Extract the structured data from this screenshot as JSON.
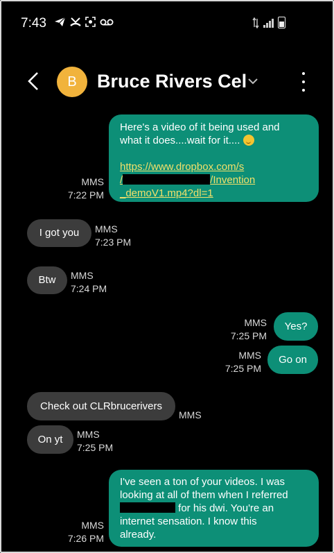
{
  "status_bar": {
    "time": "7:43",
    "left_icons": [
      "telegram-icon",
      "missed-call-icon",
      "screenshot-icon",
      "voicemail-icon"
    ],
    "right_icons": [
      "data-arrows-icon",
      "signal-icon",
      "battery-icon"
    ]
  },
  "header": {
    "avatar_letter": "B",
    "avatar_color": "#f1b33c",
    "contact_name": "Bruce Rivers Cel"
  },
  "colors": {
    "sent_bubble": "#0d8f77",
    "received_bubble": "#3c3c3c",
    "link": "#f2e06a"
  },
  "messages": [
    {
      "direction": "sent",
      "line1": "Here's a video of it being used and",
      "line2": "what it does....wait for it....",
      "link_line1": "https://www.dropbox.com/s",
      "link_line2_start": "/",
      "link_line2_end": "/Invention",
      "link_line3": "_demoV1.mp4?dl=1",
      "type": "MMS",
      "time": "7:22 PM"
    },
    {
      "direction": "received",
      "text": "I got you",
      "type": "MMS",
      "time": "7:23 PM"
    },
    {
      "direction": "received",
      "text": "Btw",
      "type": "MMS",
      "time": "7:24 PM"
    },
    {
      "direction": "sent",
      "text": "Yes?",
      "type": "MMS",
      "time": "7:25 PM"
    },
    {
      "direction": "sent",
      "text": "Go on",
      "type": "MMS",
      "time": "7:25 PM"
    },
    {
      "direction": "received",
      "text": "Check out CLRbrucerivers",
      "type": "MMS"
    },
    {
      "direction": "received",
      "text": "On yt",
      "type": "MMS",
      "time": "7:25 PM"
    },
    {
      "direction": "sent",
      "line1": "I've seen a ton of your videos. I was",
      "line2": "looking at all of them when I referred",
      "line3_end": " for his dwi. You're an",
      "line4": "internet sensation.  I know this",
      "line5": "already.",
      "type": "MMS",
      "time": "7:26 PM"
    }
  ]
}
